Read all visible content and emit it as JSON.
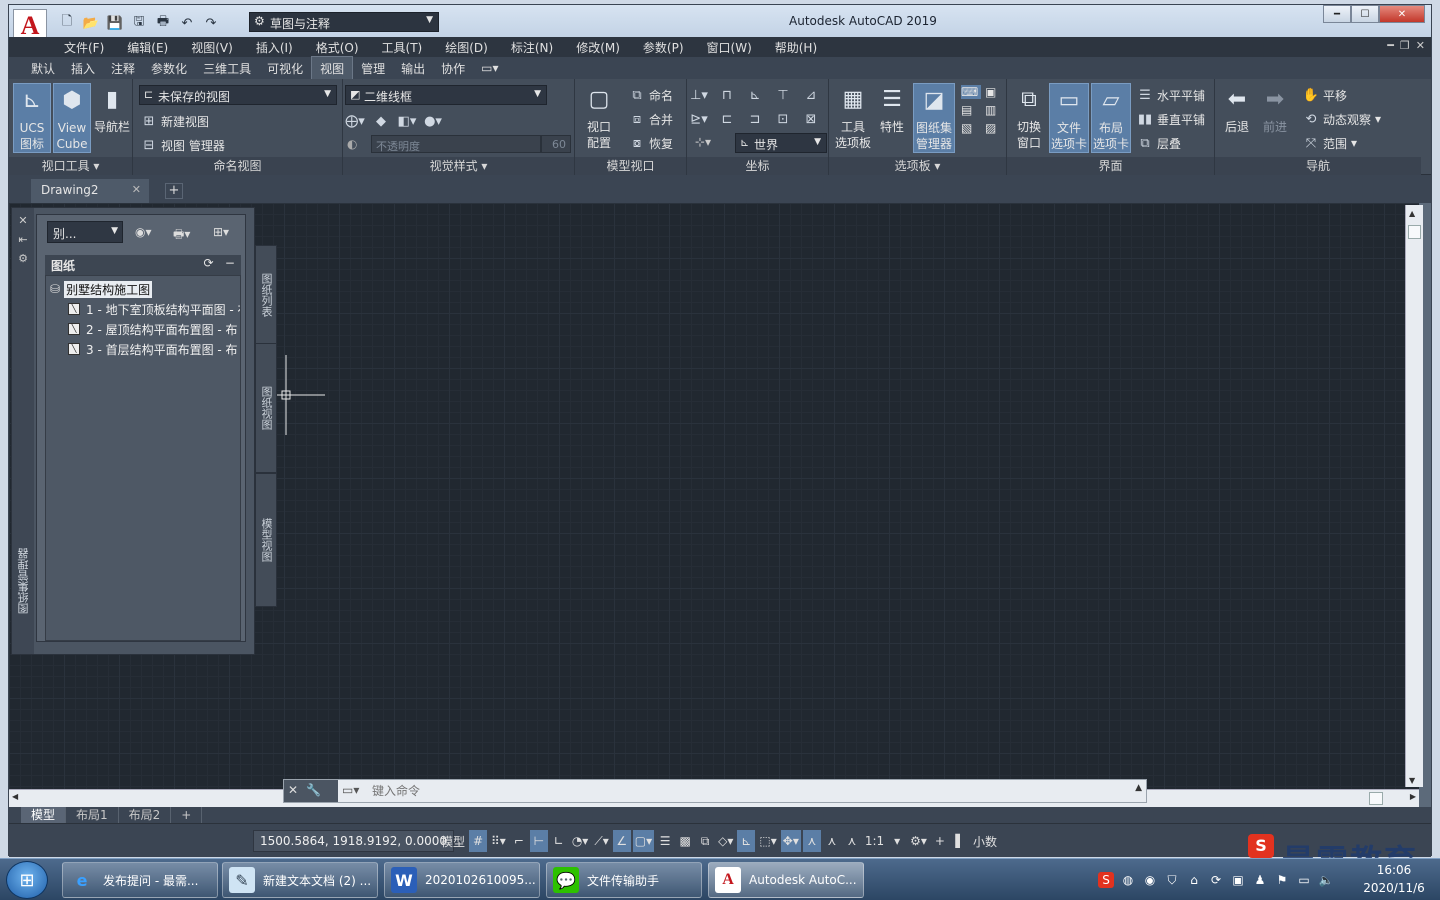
{
  "window": {
    "title": "Autodesk AutoCAD 2019",
    "logo_letter": "A",
    "workspace": "草图与注释"
  },
  "menubar": [
    "文件(F)",
    "编辑(E)",
    "视图(V)",
    "插入(I)",
    "格式(O)",
    "工具(T)",
    "绘图(D)",
    "标注(N)",
    "修改(M)",
    "参数(P)",
    "窗口(W)",
    "帮助(H)"
  ],
  "ribbon_tabs": [
    "默认",
    "插入",
    "注释",
    "参数化",
    "三维工具",
    "可视化",
    "视图",
    "管理",
    "输出",
    "协作"
  ],
  "active_tab": "视图",
  "ribbon": {
    "viewport_tools": {
      "label": "视口工具",
      "ucs": "UCS\n图标",
      "viewcube": "View\nCube",
      "navbar": "导航栏"
    },
    "named_views": {
      "label": "命名视图",
      "select": "未保存的视图",
      "new_view": "新建视图",
      "view_manager": "视图 管理器"
    },
    "visual_styles": {
      "label": "视觉样式",
      "select": "二维线框",
      "opacity_placeholder": "不透明度",
      "opacity_value": "60"
    },
    "model_viewports": {
      "label": "模型视口",
      "config": "视口\n配置",
      "name": "命名",
      "join": "合并",
      "restore": "恢复"
    },
    "coordinates": {
      "label": "坐标",
      "world": "世界"
    },
    "palettes": {
      "label": "选项板",
      "tool_palettes": "工具\n选项板",
      "properties": "特性",
      "sheet_set": "图纸集\n管理器"
    },
    "interface": {
      "label": "界面",
      "switch_window": "切换\n窗口",
      "file_tabs": "文件\n选项卡",
      "layout_tabs": "布局\n选项卡",
      "tile_h": "水平平铺",
      "tile_v": "垂直平铺",
      "cascade": "层叠"
    },
    "navigate": {
      "label": "导航",
      "back": "后退",
      "forward": "前进",
      "pan": "平移",
      "orbit": "动态观察",
      "extents": "范围"
    }
  },
  "doc_tab": "Drawing2",
  "sheet_set_manager": {
    "title": "图纸集管理器",
    "combo": "别...",
    "section": "图纸",
    "root": "别墅结构施工图",
    "sheets": [
      "1 - 地下室顶板结构平面图 - 布",
      "2 - 屋顶结构平面布置图 - 布",
      "3 - 首层结构平面布置图 - 布"
    ],
    "side_tabs": [
      "图纸列表",
      "图纸视图",
      "模型视图"
    ]
  },
  "command_line": {
    "placeholder": "键入命令"
  },
  "layout_tabs": [
    "模型",
    "布局1",
    "布局2"
  ],
  "status": {
    "coords": "1500.5864, 1918.9192, 0.0000",
    "model": "模型",
    "scale": "1:1",
    "units": "小数"
  },
  "watermark": "最需教育",
  "taskbar": {
    "tasks": [
      {
        "label": "发布提问 - 最需...",
        "icon": "ie-icon"
      },
      {
        "label": "新建文本文档 (2) ...",
        "icon": "notepad-icon"
      },
      {
        "label": "2020102610095...",
        "icon": "word-icon"
      },
      {
        "label": "文件传输助手",
        "icon": "wechat-icon"
      },
      {
        "label": "Autodesk AutoC...",
        "icon": "autocad-icon"
      }
    ],
    "time": "16:06",
    "date": "2020/11/6"
  },
  "colors": {
    "canvas": "#212830",
    "ribbon": "#444e5b",
    "accent": "#5b7ea6",
    "autocad_red": "#c3161c"
  }
}
